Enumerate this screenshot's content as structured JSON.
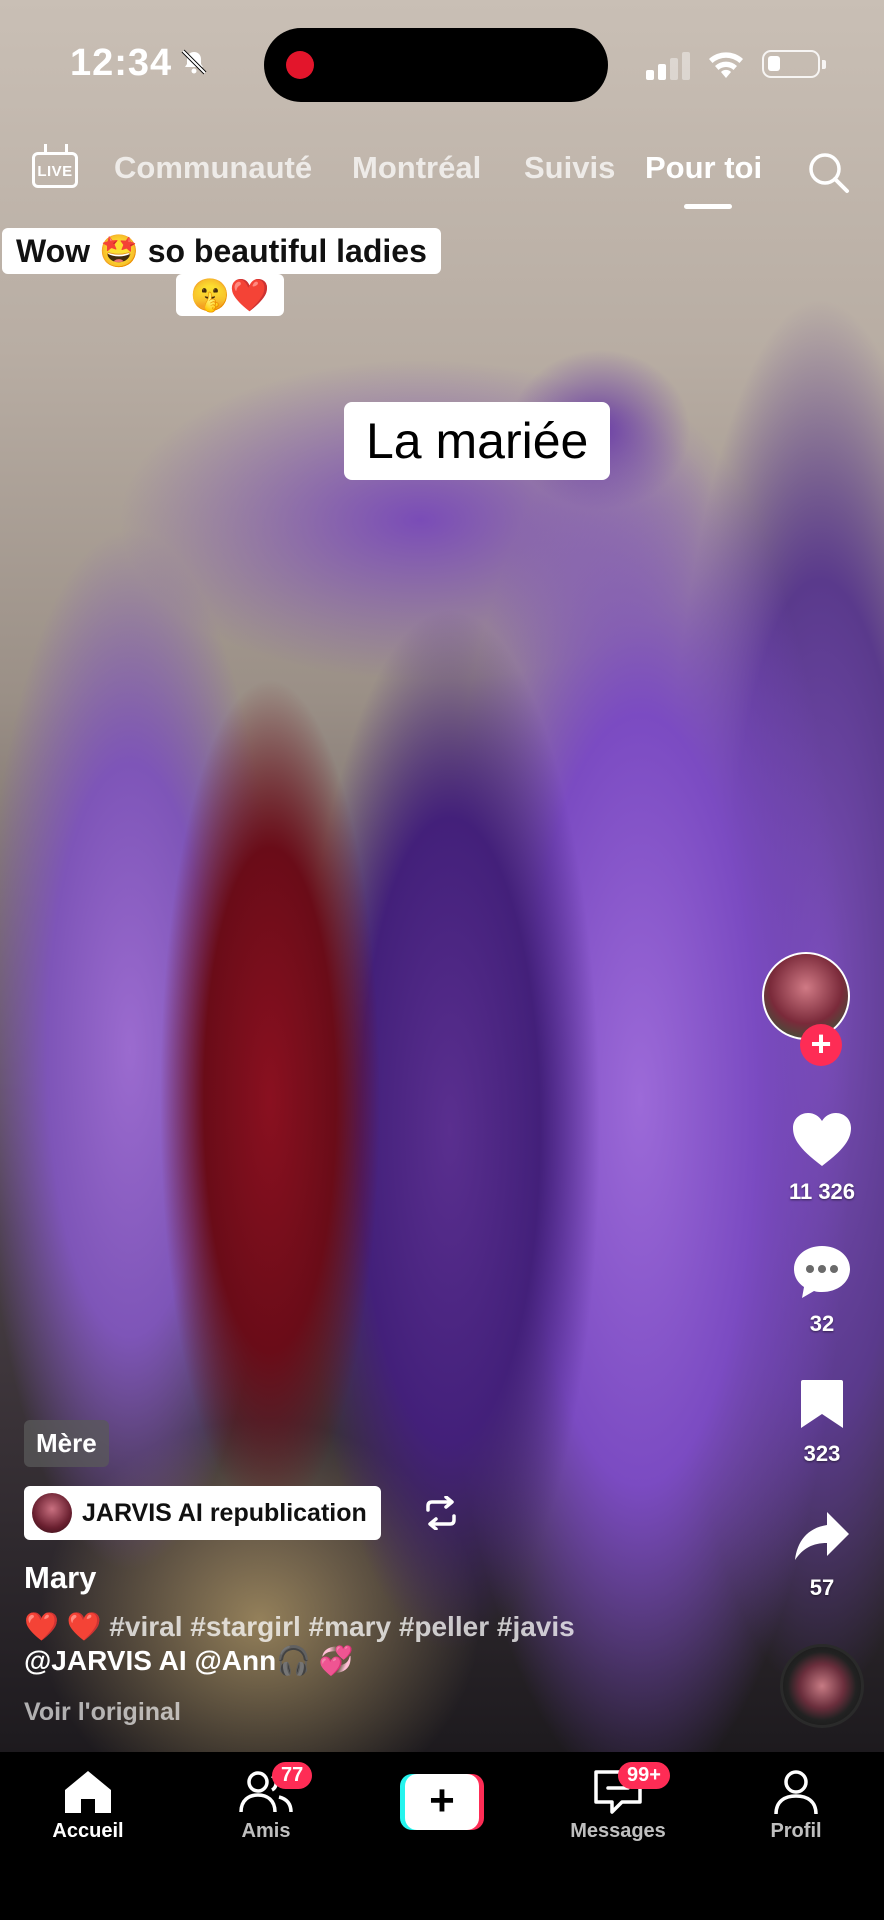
{
  "status_bar": {
    "time": "12:34"
  },
  "top_nav": {
    "live_label": "LIVE",
    "tabs": [
      {
        "label": "Communauté"
      },
      {
        "label": "Montréal"
      },
      {
        "label": "Suivis"
      },
      {
        "label": "Pour toi",
        "active": true
      }
    ]
  },
  "video": {
    "caption_line1": "Wow 🤩 so beautiful ladies",
    "caption_line2": "🤫❤️",
    "overlay_text": "La mariée"
  },
  "actions": {
    "likes": "11 326",
    "comments": "32",
    "saves": "323",
    "shares": "57"
  },
  "post": {
    "tag_badge": "Mère",
    "republish_label": "JARVIS AI republication",
    "author": "Mary",
    "desc_hearts": "❤️ ❤️",
    "desc_tags": "#viral #stargirl #mary #peller #javis",
    "desc_mentions": "@JARVIS AI @Ann🎧 💞",
    "see_original": "Voir l'original"
  },
  "bottom_nav": {
    "home": "Accueil",
    "friends": "Amis",
    "friends_badge": "77",
    "messages": "Messages",
    "messages_badge": "99+",
    "profile": "Profil",
    "create_symbol": "+"
  },
  "colors": {
    "accent_red": "#fe2c55",
    "accent_cyan": "#25f4ee",
    "recording_dot": "#e3152b"
  }
}
